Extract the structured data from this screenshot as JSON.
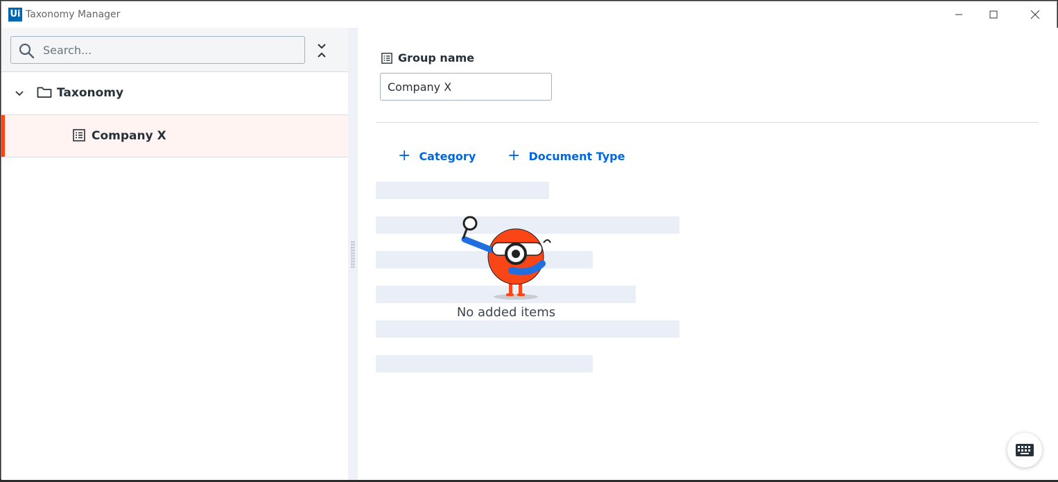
{
  "window": {
    "logo_text": "Ui",
    "title": "Taxonomy Manager"
  },
  "search": {
    "placeholder": "Search..."
  },
  "tree": {
    "root": {
      "label": "Taxonomy",
      "icon": "folder-icon",
      "expanded": true
    },
    "children": [
      {
        "label": "Company X",
        "icon": "list-icon",
        "selected": true
      }
    ]
  },
  "details": {
    "group_name_label": "Group name",
    "group_name_value": "Company X",
    "add_category_label": "Category",
    "add_document_type_label": "Document Type",
    "empty_state_text": "No added items"
  },
  "colors": {
    "accent_blue": "#0067df",
    "selection_orange": "#fa4616",
    "selection_bg": "#fff4f1",
    "skeleton": "#e9eef7"
  }
}
